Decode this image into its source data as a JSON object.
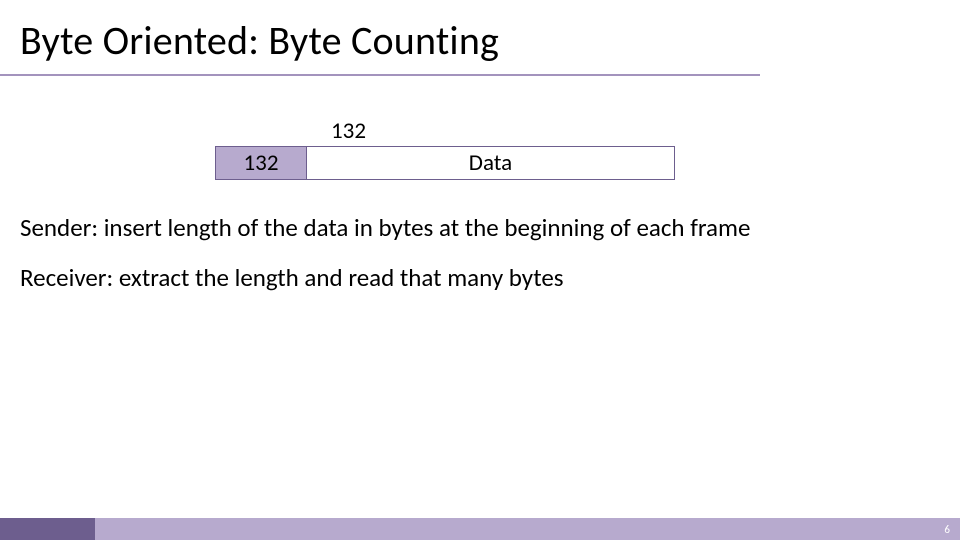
{
  "title": "Byte Oriented: Byte Counting",
  "diagram": {
    "size_annotation": "132",
    "length_value": "132",
    "data_label": "Data"
  },
  "body": {
    "sender": "Sender: insert length of the data in bytes at the beginning of each frame",
    "receiver": "Receiver: extract the length and read that many bytes"
  },
  "page_number": "6"
}
